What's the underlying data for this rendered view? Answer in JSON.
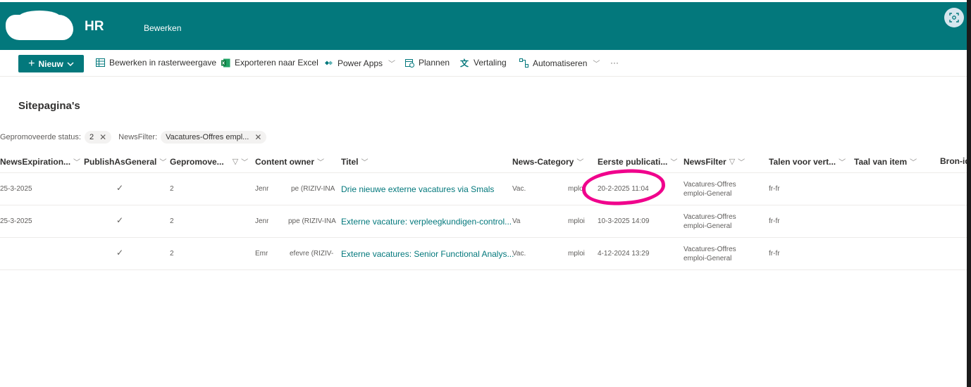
{
  "header": {
    "site_title": "HR",
    "edit_link": "Bewerken",
    "brand_color": "#03787c"
  },
  "commandbar": {
    "new_label": "Nieuw",
    "items": [
      {
        "label": "Bewerken in rasterweergave",
        "icon": "grid-icon"
      },
      {
        "label": "Exporteren naar Excel",
        "icon": "excel-icon"
      },
      {
        "label": "Power Apps",
        "icon": "power-apps-icon"
      },
      {
        "label": "Plannen",
        "icon": "planner-icon"
      },
      {
        "label": "Vertaling",
        "icon": "translate-icon"
      },
      {
        "label": "Automatiseren",
        "icon": "flow-icon"
      }
    ],
    "more": "···"
  },
  "page_title": "Sitepagina's",
  "filters": {
    "promoted_label": "Gepromoveerde status:",
    "promoted_value": "2",
    "newsfilter_label": "NewsFilter:",
    "newsfilter_value": "Vacatures-Offres empl..."
  },
  "columns": [
    "NewsExpiration...",
    "PublishAsGeneral",
    "Gepromove...",
    "Content owner",
    "Titel",
    "News-Category",
    "Eerste publicati...",
    "NewsFilter",
    "Talen voor vert...",
    "Taal van item",
    "Bron-id"
  ],
  "rows": [
    {
      "expiration": "25-3-2025",
      "promoted": "2",
      "owner_a": "Jenr",
      "owner_b": "pe (RIZIV-INA",
      "title": "Drie nieuwe externe vacatures via Smals",
      "category_a": "Vac.",
      "category_b": "mploi",
      "first_published": "20-2-2025 11:04",
      "newsfilter_1": "Vacatures-Offres",
      "newsfilter_2": "emploi-General",
      "languages": "fr-fr"
    },
    {
      "expiration": "25-3-2025",
      "promoted": "2",
      "owner_a": "Jenr",
      "owner_b": "ppe (RIZIV-INA",
      "title": "Externe vacature: verpleegkundigen-control...",
      "category_a": "Va",
      "category_b": "mploi",
      "first_published": "10-3-2025 14:09",
      "newsfilter_1": "Vacatures-Offres",
      "newsfilter_2": "emploi-General",
      "languages": "fr-fr"
    },
    {
      "expiration": "",
      "promoted": "2",
      "owner_a": "Emr",
      "owner_b": "efevre (RIZIV-",
      "title": "Externe vacatures: Senior Functional Analys...",
      "category_a": "Vac.",
      "category_b": "mploi",
      "first_published": "4-12-2024 13:29",
      "newsfilter_1": "Vacatures-Offres",
      "newsfilter_2": "emploi-General",
      "languages": "fr-fr"
    }
  ],
  "annotation_color": "#f0008c"
}
